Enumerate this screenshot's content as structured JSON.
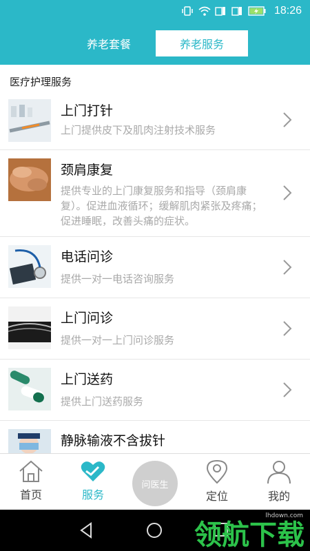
{
  "status_bar": {
    "time": "18:26"
  },
  "top_tabs": {
    "tab1": "养老套餐",
    "tab2": "养老服务"
  },
  "section_title": "医疗护理服务",
  "items": [
    {
      "title": "上门打针",
      "desc": "上门提供皮下及肌肉注射技术服务"
    },
    {
      "title": "颈肩康复",
      "desc": "提供专业的上门康复服务和指导（颈肩康复）。促进血液循环；缓解肌肉紧张及疼痛；促进睡眠，改善头痛的症状。"
    },
    {
      "title": "电话问诊",
      "desc": "提供一对一电话咨询服务"
    },
    {
      "title": "上门问诊",
      "desc": "提供一对一上门问诊服务"
    },
    {
      "title": "上门送药",
      "desc": "提供上门送药服务"
    },
    {
      "title": "静脉输液不含拔针",
      "desc": ""
    }
  ],
  "bottom_nav": {
    "home": "首页",
    "service": "服务",
    "center": "问医生",
    "location": "定位",
    "mine": "我的"
  },
  "watermark": {
    "big": "领航下载",
    "small": "lhdown.com"
  },
  "colors": {
    "accent": "#2bb8c8",
    "watermark": "#2cc24a"
  }
}
